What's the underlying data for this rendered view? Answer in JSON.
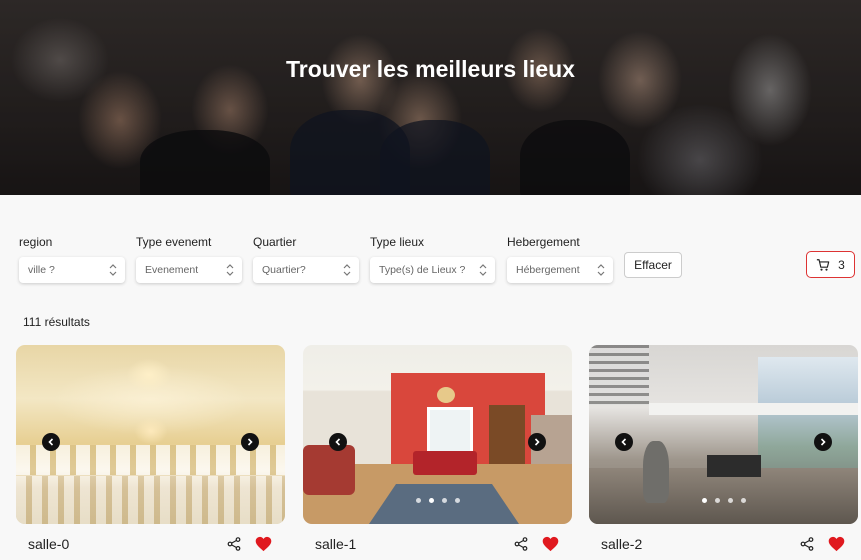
{
  "hero": {
    "title": "Trouver les meilleurs lieux"
  },
  "filters": [
    {
      "label": "region",
      "placeholder": "ville ?"
    },
    {
      "label": "Type evenemt",
      "placeholder": "Evenement"
    },
    {
      "label": "Quartier",
      "placeholder": "Quartier?"
    },
    {
      "label": "Type lieux",
      "placeholder": "Type(s) de Lieux ?"
    },
    {
      "label": "Hebergement",
      "placeholder": "Hébergement"
    }
  ],
  "clear_button": "Effacer",
  "cart": {
    "count": "3",
    "icon": "cart-icon",
    "border_color": "#d33333"
  },
  "results_count": "111 résultats",
  "cards": [
    {
      "name": "salle-0",
      "image": "ballroom",
      "active_slide": 0,
      "slides": 0
    },
    {
      "name": "salle-1",
      "image": "dining-room",
      "active_slide": 1,
      "slides": 4
    },
    {
      "name": "salle-2",
      "image": "modern-living-room",
      "active_slide": 0,
      "slides": 4
    }
  ],
  "colors": {
    "favorite": "#e0191f",
    "arrow_bg": "#111111"
  }
}
